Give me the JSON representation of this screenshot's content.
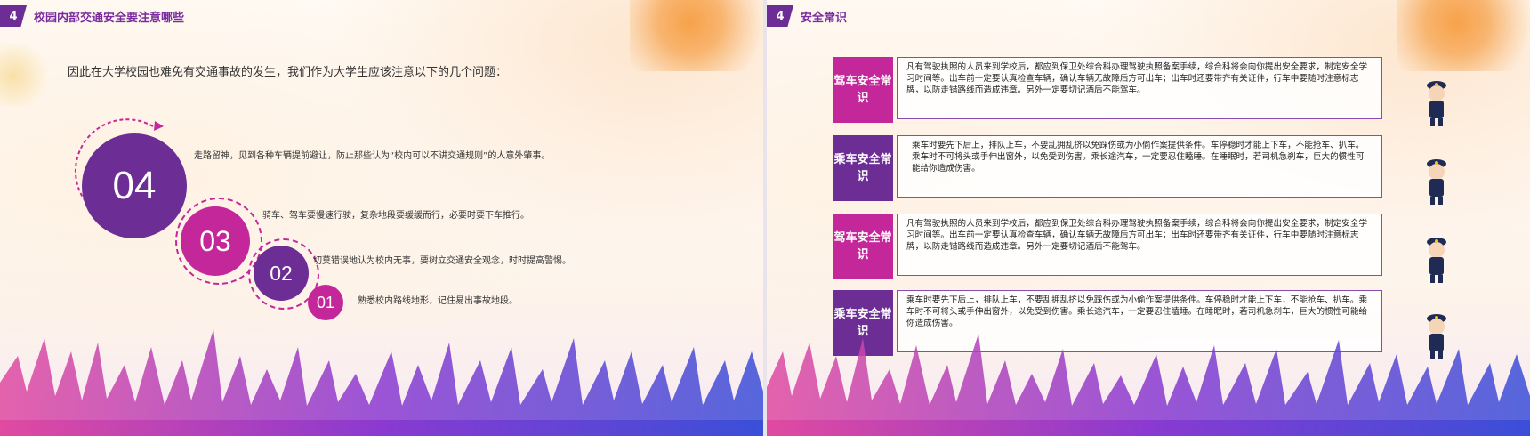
{
  "left_slide": {
    "section_number": "4",
    "section_title": "校园内部交通安全要注意哪些",
    "intro": "因此在大学校园也难免有交通事故的发生，我们作为大学生应该注意以下的几个问题：",
    "items": [
      {
        "number": "04",
        "text": "走路留神，见到各种车辆提前避让，防止那些认为“校内可以不讲交通规则”的人意外肇事。"
      },
      {
        "number": "03",
        "text": "骑车、驾车要慢速行驶，复杂地段要缓缓而行，必要时要下车推行。"
      },
      {
        "number": "02",
        "text": "切莫错误地认为校内无事，要树立交通安全观念，时时提高警惕。"
      },
      {
        "number": "01",
        "text": "熟悉校内路线地形，记住易出事故地段。"
      }
    ]
  },
  "right_slide": {
    "section_number": "4",
    "section_title": "安全常识",
    "cards": [
      {
        "label": "驾车安全常识",
        "text": "凡有驾驶执照的人员来到学校后，都应到保卫处综合科办理驾驶执照备案手续，综合科将会向你提出安全要求，制定安全学习时间等。出车前一定要认真检查车辆，确认车辆无故障后方可出车；出车时还要带齐有关证件，行车中要随时注意标志牌，以防走错路线而造成违章。另外一定要切记酒后不能驾车。"
      },
      {
        "label": "乘车安全常识",
        "text": "乘车时要先下后上，排队上车，不要乱拥乱挤以免踩伤或为小偷作案提供条件。车停稳时才能上下车，不能抢车、扒车。乘车时不可将头或手伸出窗外，以免受到伤害。乘长途汽车，一定要忍住瞌睡。在睡眠时，若司机急刹车，巨大的惯性可能给你造成伤害。"
      },
      {
        "label": "驾车安全常识",
        "text": "凡有驾驶执照的人员来到学校后，都应到保卫处综合科办理驾驶执照备案手续，综合科将会向你提出安全要求，制定安全学习时间等。出车前一定要认真检查车辆，确认车辆无故障后方可出车；出车时还要带齐有关证件，行车中要随时注意标志牌，以防走错路线而造成违章。另外一定要切记酒后不能驾车。"
      },
      {
        "label": "乘车安全常识",
        "text": "乘车时要先下后上，排队上车，不要乱拥乱挤以免踩伤或为小偷作案提供条件。车停稳时才能上下车，不能抢车、扒车。乘车时不可将头或手伸出窗外，以免受到伤害。乘长途汽车，一定要忍住瞌睡。在睡眠时，若司机急刹车，巨大的惯性可能给你造成伤害。"
      }
    ]
  },
  "colors": {
    "purple": "#6c2d95",
    "magenta": "#c4279a",
    "header": "#7a2b9e"
  }
}
